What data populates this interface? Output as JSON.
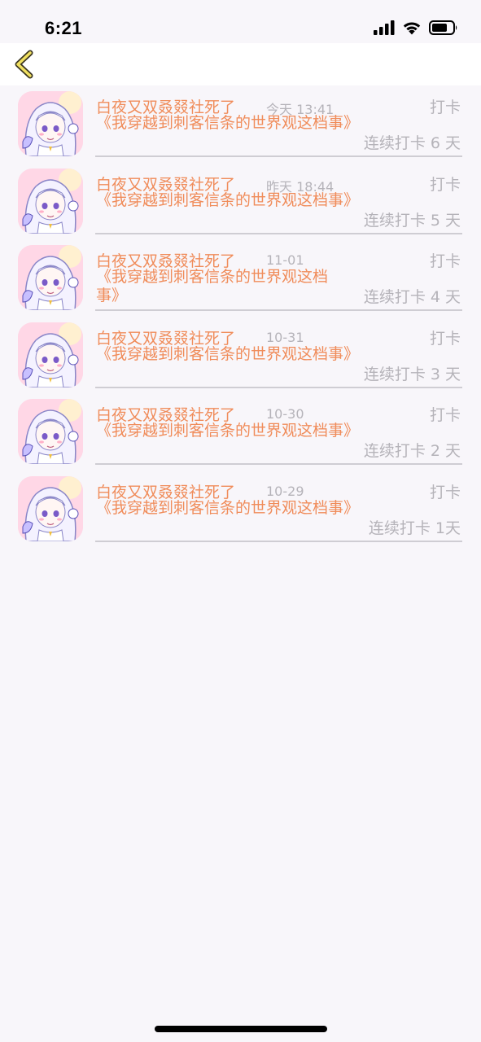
{
  "status_bar": {
    "time": "6:21",
    "icons": [
      "signal-icon",
      "wifi-icon",
      "battery-icon"
    ]
  },
  "nav": {
    "back_icon": "chevron-left-icon",
    "accent_color": "#f0e060"
  },
  "colors": {
    "author": "#f08c5a",
    "muted": "#b5b3b9",
    "background": "#f8f6fa",
    "divider": "#cfcdd3"
  },
  "rows": [
    {
      "author": "白夜又双叒叕社死了",
      "time": "今天 13:41",
      "action": "打卡",
      "book": "《我穿越到刺客信条的世界观这档事》",
      "streak": "连续打卡 6 天"
    },
    {
      "author": "白夜又双叒叕社死了",
      "time": "昨天 18:44",
      "action": "打卡",
      "book": "《我穿越到刺客信条的世界观这档事》",
      "streak": "连续打卡 5 天"
    },
    {
      "author": "白夜又双叒叕社死了",
      "time": "11-01",
      "action": "打卡",
      "book": "《我穿越到刺客信条的世界观这档事》",
      "streak": "连续打卡 4 天"
    },
    {
      "author": "白夜又双叒叕社死了",
      "time": "10-31",
      "action": "打卡",
      "book": "《我穿越到刺客信条的世界观这档事》",
      "streak": "连续打卡 3 天"
    },
    {
      "author": "白夜又双叒叕社死了",
      "time": "10-30",
      "action": "打卡",
      "book": "《我穿越到刺客信条的世界观这档事》",
      "streak": "连续打卡 2 天"
    },
    {
      "author": "白夜又双叒叕社死了",
      "time": "10-29",
      "action": "打卡",
      "book": "《我穿越到刺客信条的世界观这档事》",
      "streak": "连续打卡 1天"
    }
  ]
}
